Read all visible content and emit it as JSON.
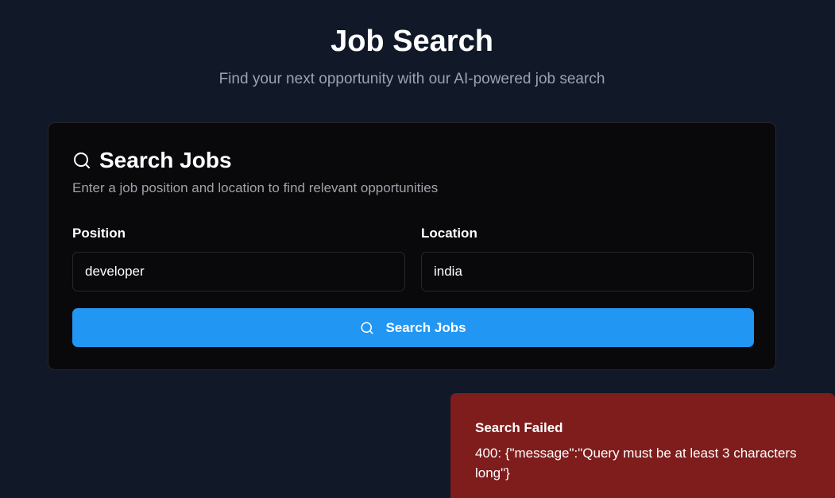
{
  "header": {
    "title": "Job Search",
    "subtitle": "Find your next opportunity with our AI-powered job search"
  },
  "card": {
    "title": "Search Jobs",
    "title_icon": "search-icon",
    "description": "Enter a job position and location to find relevant opportunities"
  },
  "form": {
    "position": {
      "label": "Position",
      "value": "developer"
    },
    "location": {
      "label": "Location",
      "value": "india"
    },
    "submit": {
      "label": "Search Jobs",
      "icon": "search-icon"
    }
  },
  "toast": {
    "title": "Search Failed",
    "message": "400: {\"message\":\"Query must be at least 3 characters long\"}"
  },
  "colors": {
    "background": "#111827",
    "card": "#09090b",
    "accent": "#2196f3",
    "error": "#7f1d1d"
  }
}
